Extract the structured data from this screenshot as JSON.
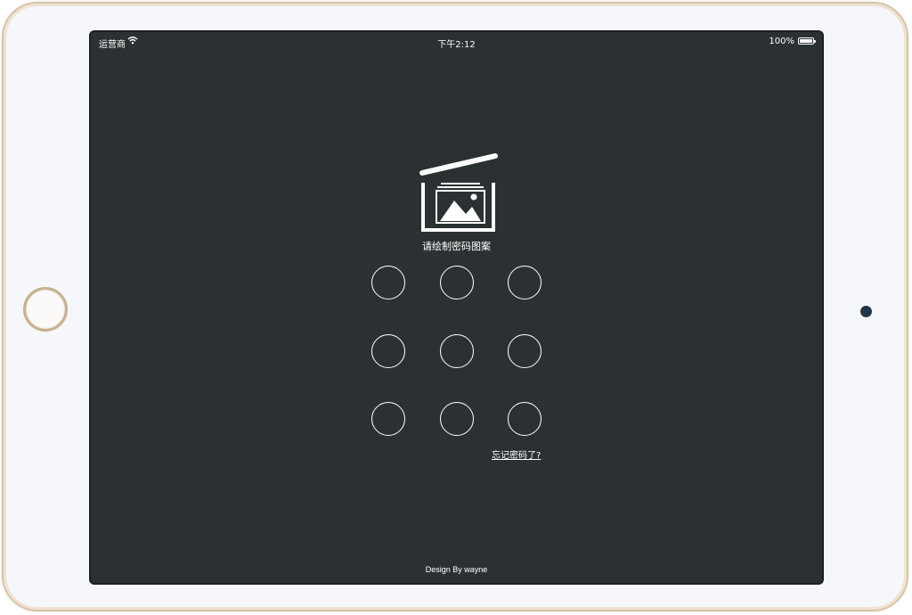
{
  "status_bar": {
    "carrier": "运营商",
    "time": "下午2:12",
    "battery": "100%"
  },
  "lock_screen": {
    "prompt": "请绘制密码图案",
    "forgot_link": "忘记密码了?",
    "footer": "Design By wayne"
  },
  "icons": {
    "logo": "photo-box-icon",
    "wifi": "wifi-icon",
    "battery": "battery-icon"
  },
  "colors": {
    "screen_background": "#2b3133",
    "foreground": "#ffffff"
  }
}
